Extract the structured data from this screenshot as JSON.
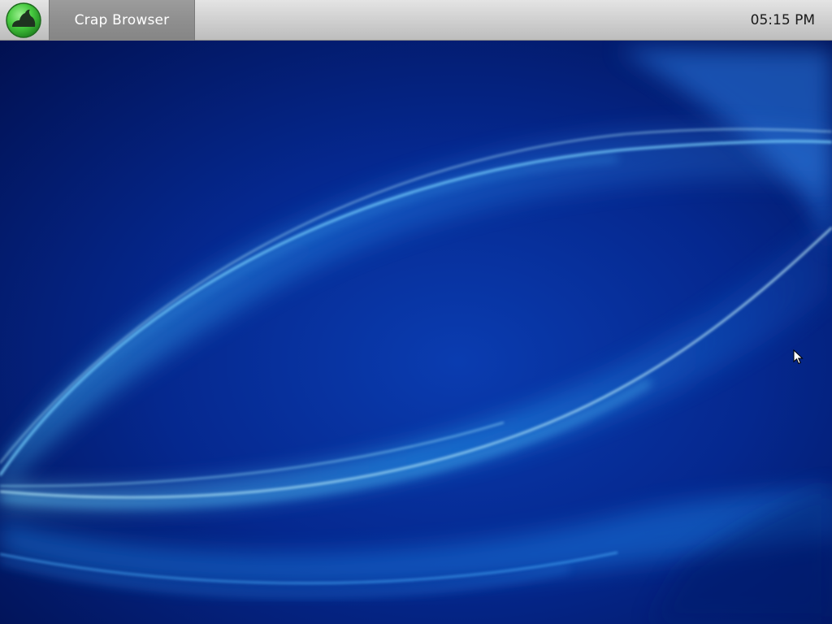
{
  "taskbar": {
    "start_icon": "green-blob-logo-icon",
    "task_item_label": "Crap Browser",
    "clock_text": "05:15 PM"
  },
  "desktop": {
    "wallpaper": "blue-light-waves",
    "cursor_icon": "arrow-pointer-icon"
  },
  "colors": {
    "taskbar_bg": "#d2d2d2",
    "task_item_bg": "#8f8f8f",
    "start_green": "#4fd34a",
    "wallpaper_base": "#021a6e",
    "wave_highlight": "#37b4ff"
  }
}
